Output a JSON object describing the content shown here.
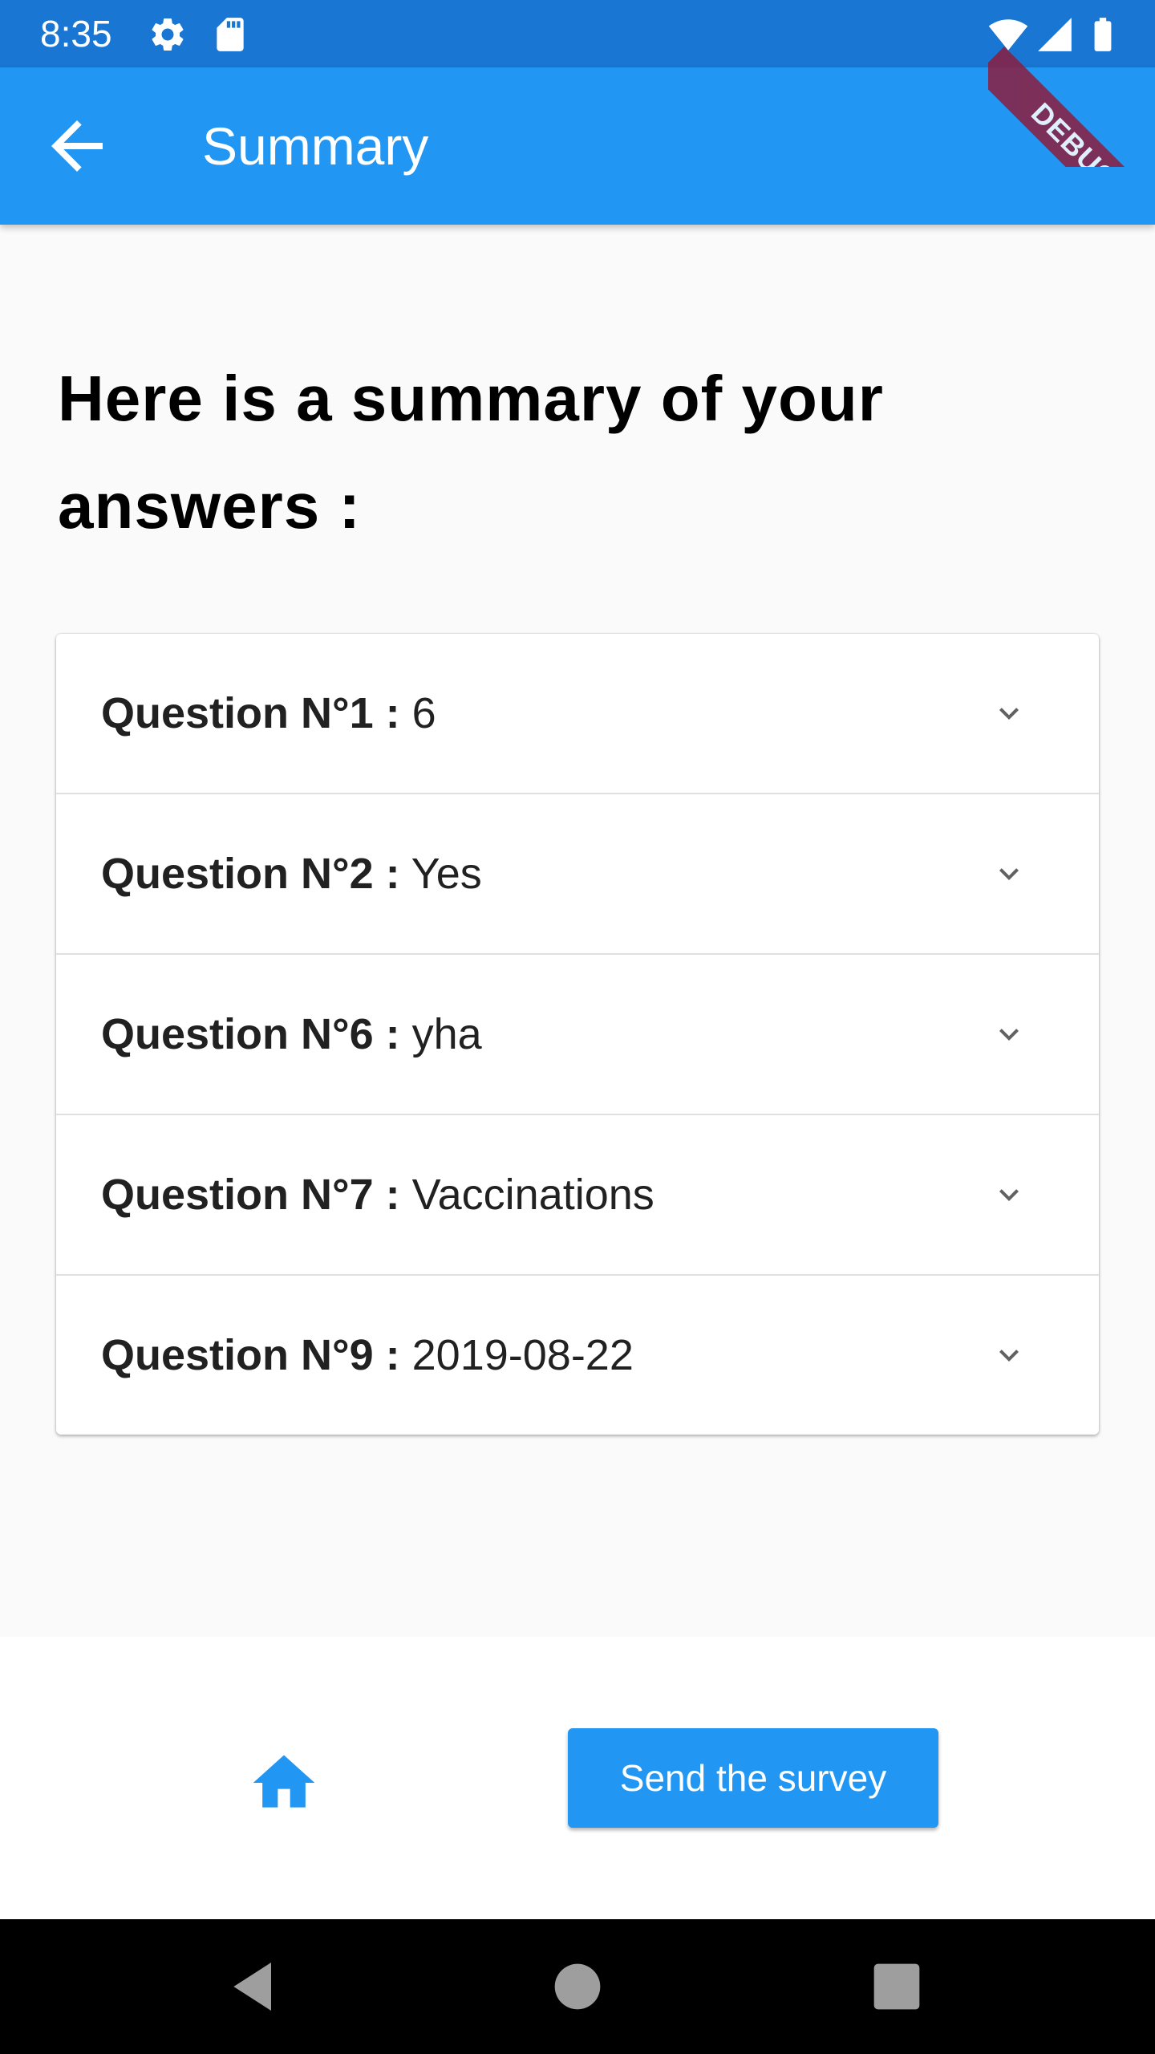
{
  "status_bar": {
    "time": "8:35",
    "icons": [
      "gear-icon",
      "sd-card-icon",
      "wifi-icon",
      "cell-signal-icon",
      "battery-icon"
    ]
  },
  "debug_banner": {
    "label": "DEBUG"
  },
  "app_bar": {
    "title": "Summary",
    "back_icon": "arrow-back-icon"
  },
  "main": {
    "heading": "Here is a summary of your answers :",
    "answers": [
      {
        "label": "Question N°1 :",
        "value": "6"
      },
      {
        "label": "Question N°2 :",
        "value": "Yes"
      },
      {
        "label": "Question N°6 :",
        "value": "yha"
      },
      {
        "label": "Question N°7 :",
        "value": "Vaccinations"
      },
      {
        "label": "Question N°9 :",
        "value": "2019-08-22"
      }
    ],
    "expand_icon": "chevron-down-icon"
  },
  "bottom": {
    "home_icon": "home-icon",
    "send_label": "Send the survey"
  },
  "nav_bar": {
    "icons": [
      "back-triangle-icon",
      "home-circle-icon",
      "recents-square-icon"
    ]
  },
  "colors": {
    "status_bar": "#1976d2",
    "primary": "#2196f3",
    "debug_ribbon": "#8b1e3f",
    "background": "#fafafa"
  }
}
